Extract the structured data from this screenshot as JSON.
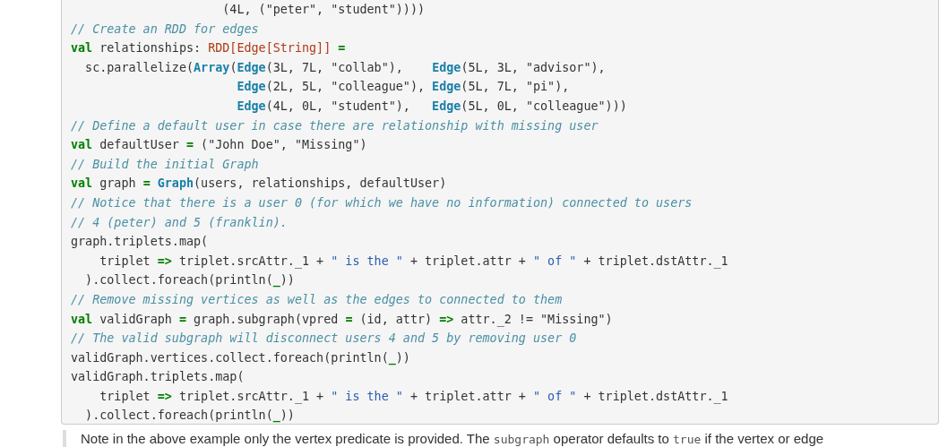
{
  "code_block": {
    "lines": [
      [
        {
          "kind": "plain",
          "text": "                     (4L, (\"peter\", \"student\"))))"
        }
      ],
      [
        {
          "kind": "comment",
          "text": "// Create an RDD for edges"
        }
      ],
      [
        {
          "kind": "keyword",
          "text": "val"
        },
        {
          "kind": "plain",
          "text": " relationships: "
        },
        {
          "kind": "type",
          "text": "RDD[Edge[String]]"
        },
        {
          "kind": "keyword",
          "text": " ="
        }
      ],
      [
        {
          "kind": "plain",
          "text": "  sc.parallelize("
        },
        {
          "kind": "class",
          "text": "Array"
        },
        {
          "kind": "plain",
          "text": "("
        },
        {
          "kind": "class",
          "text": "Edge"
        },
        {
          "kind": "plain",
          "text": "(3L, 7L, \"collab\"),    "
        },
        {
          "kind": "class",
          "text": "Edge"
        },
        {
          "kind": "plain",
          "text": "(5L, 3L, \"advisor\"),"
        }
      ],
      [
        {
          "kind": "class",
          "text": "                       Edge"
        },
        {
          "kind": "plain",
          "text": "(2L, 5L, \"colleague\"), "
        },
        {
          "kind": "class",
          "text": "Edge"
        },
        {
          "kind": "plain",
          "text": "(5L, 7L, \"pi\"),"
        }
      ],
      [
        {
          "kind": "class",
          "text": "                       Edge"
        },
        {
          "kind": "plain",
          "text": "(4L, 0L, \"student\"),   "
        },
        {
          "kind": "class",
          "text": "Edge"
        },
        {
          "kind": "plain",
          "text": "(5L, 0L, \"colleague\")))"
        }
      ],
      [
        {
          "kind": "comment",
          "text": "// Define a default user in case there are relationship with missing user"
        }
      ],
      [
        {
          "kind": "keyword",
          "text": "val"
        },
        {
          "kind": "plain",
          "text": " defaultUser "
        },
        {
          "kind": "keyword",
          "text": "="
        },
        {
          "kind": "plain",
          "text": " (\"John Doe\", \"Missing\")"
        }
      ],
      [
        {
          "kind": "comment",
          "text": "// Build the initial Graph"
        }
      ],
      [
        {
          "kind": "keyword",
          "text": "val"
        },
        {
          "kind": "plain",
          "text": " graph "
        },
        {
          "kind": "keyword",
          "text": "="
        },
        {
          "kind": "class",
          "text": " Graph"
        },
        {
          "kind": "plain",
          "text": "(users, relationships, defaultUser)"
        }
      ],
      [
        {
          "kind": "comment",
          "text": "// Notice that there is a user 0 (for which we have no information) connected to users"
        }
      ],
      [
        {
          "kind": "comment",
          "text": "// 4 (peter) and 5 (franklin)."
        }
      ],
      [
        {
          "kind": "plain",
          "text": "graph.triplets.map("
        }
      ],
      [
        {
          "kind": "plain",
          "text": "    triplet "
        },
        {
          "kind": "keyword",
          "text": "=>"
        },
        {
          "kind": "plain",
          "text": " triplet.srcAttr._1 + "
        },
        {
          "kind": "string",
          "text": "\" is the \""
        },
        {
          "kind": "plain",
          "text": " + triplet.attr + "
        },
        {
          "kind": "string",
          "text": "\" of \""
        },
        {
          "kind": "plain",
          "text": " + triplet.dstAttr._1"
        }
      ],
      [
        {
          "kind": "plain",
          "text": "  ).collect.foreach(println("
        },
        {
          "kind": "keyword",
          "text": "_"
        },
        {
          "kind": "plain",
          "text": "))"
        }
      ],
      [
        {
          "kind": "comment",
          "text": "// Remove missing vertices as well as the edges to connected to them"
        }
      ],
      [
        {
          "kind": "keyword",
          "text": "val"
        },
        {
          "kind": "plain",
          "text": " validGraph "
        },
        {
          "kind": "keyword",
          "text": "="
        },
        {
          "kind": "plain",
          "text": " graph.subgraph(vpred "
        },
        {
          "kind": "keyword",
          "text": "="
        },
        {
          "kind": "plain",
          "text": " (id, attr) "
        },
        {
          "kind": "keyword",
          "text": "=>"
        },
        {
          "kind": "plain",
          "text": " attr._2 != \"Missing\")"
        }
      ],
      [
        {
          "kind": "comment",
          "text": "// The valid subgraph will disconnect users 4 and 5 by removing user 0"
        }
      ],
      [
        {
          "kind": "plain",
          "text": "validGraph.vertices.collect.foreach(println("
        },
        {
          "kind": "keyword",
          "text": "_"
        },
        {
          "kind": "plain",
          "text": "))"
        }
      ],
      [
        {
          "kind": "plain",
          "text": "validGraph.triplets.map("
        }
      ],
      [
        {
          "kind": "plain",
          "text": "    triplet "
        },
        {
          "kind": "keyword",
          "text": "=>"
        },
        {
          "kind": "plain",
          "text": " triplet.srcAttr._1 + "
        },
        {
          "kind": "string",
          "text": "\" is the \""
        },
        {
          "kind": "plain",
          "text": " + triplet.attr + "
        },
        {
          "kind": "string",
          "text": "\" of \""
        },
        {
          "kind": "plain",
          "text": " + triplet.dstAttr._1"
        }
      ],
      [
        {
          "kind": "plain",
          "text": "  ).collect.foreach(println("
        },
        {
          "kind": "keyword",
          "text": "_"
        },
        {
          "kind": "plain",
          "text": "))"
        }
      ]
    ]
  },
  "note": [
    {
      "kind": "text",
      "text": "Note in the above example only the vertex predicate is provided. The "
    },
    {
      "kind": "code",
      "text": "subgraph"
    },
    {
      "kind": "text",
      "text": " operator defaults to "
    },
    {
      "kind": "code",
      "text": "true"
    },
    {
      "kind": "text",
      "text": " if the vertex or edge"
    }
  ]
}
